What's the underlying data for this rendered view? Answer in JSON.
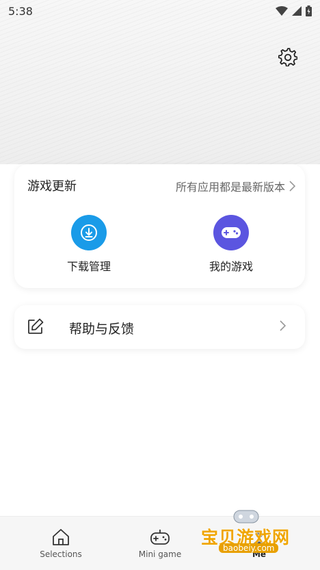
{
  "status_bar": {
    "time": "5:38"
  },
  "update_card": {
    "title": "游戏更新",
    "status": "所有应用都是最新版本",
    "tools": [
      {
        "label": "下载管理",
        "icon": "download-icon",
        "color": "#1a9be8"
      },
      {
        "label": "我的游戏",
        "icon": "gamepad-icon",
        "color": "#5b55e0"
      }
    ]
  },
  "help": {
    "label": "帮助与反馈"
  },
  "bottom_nav": {
    "items": [
      {
        "label": "Selections",
        "icon": "home-icon"
      },
      {
        "label": "Mini game",
        "icon": "gamepad-icon"
      },
      {
        "label": "Me",
        "icon": "profile-icon"
      }
    ]
  },
  "watermark": {
    "title": "宝贝游戏网",
    "url": "baobeiy.com"
  }
}
